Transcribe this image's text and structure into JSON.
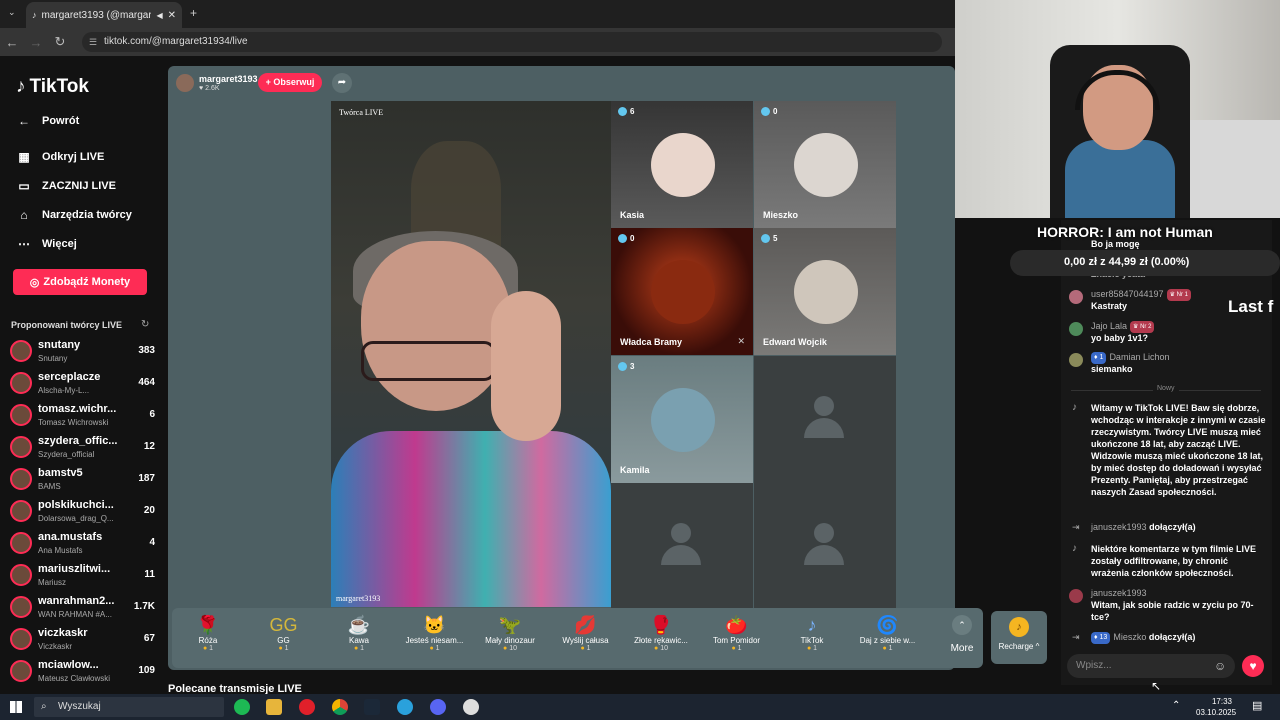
{
  "browser": {
    "tab_title": "margaret3193 (@margaret3...",
    "url": "tiktok.com/@margaret31934/live"
  },
  "sidebar": {
    "logo": "TikTok",
    "back": "Powrót",
    "nav": [
      "Odkryj LIVE",
      "ZACZNIJ LIVE",
      "Narzędzia twórcy",
      "Więcej"
    ],
    "coins_button": "Zdobądź Monety",
    "suggested_title": "Proponowani twórcy LIVE",
    "creators": [
      {
        "name": "snutany",
        "sub": "Snutany",
        "count": "383"
      },
      {
        "name": "serceplacze",
        "sub": "Alscha-My-L...",
        "count": "464"
      },
      {
        "name": "tomasz.wichr...",
        "sub": "Tomasz Wichrowski",
        "count": "6"
      },
      {
        "name": "szydera_offic...",
        "sub": "Szydera_official",
        "count": "12"
      },
      {
        "name": "bamstv5",
        "sub": "BAMS",
        "count": "187"
      },
      {
        "name": "polskikuchci...",
        "sub": "Dolarsowa_drag_Q...",
        "count": "20"
      },
      {
        "name": "ana.mustafs",
        "sub": "Ana Mustafs",
        "count": "4"
      },
      {
        "name": "mariuszlitwi...",
        "sub": "Mariusz",
        "count": "11"
      },
      {
        "name": "wanrahman2...",
        "sub": "WAN RAHMAN #A...",
        "count": "1.7K"
      },
      {
        "name": "viczkaskr",
        "sub": "Viczkaskr",
        "count": "67"
      },
      {
        "name": "mciawlow...",
        "sub": "Mateusz Clawłowski",
        "count": "109"
      }
    ]
  },
  "stage": {
    "host": "margaret3193",
    "likes": "2.6K",
    "follow": "+ Obserwuj",
    "creator_label": "Twórca LIVE",
    "host_label": "margaret3193",
    "tiles": [
      {
        "name": "Kasia",
        "count": "6"
      },
      {
        "name": "Mieszko",
        "count": "0"
      },
      {
        "name": "Władca Bramy",
        "count": "0"
      },
      {
        "name": "Edward Wojcik",
        "count": "5"
      },
      {
        "name": "Kamila",
        "count": "3"
      }
    ],
    "gifts": [
      {
        "name": "Róża",
        "price": "1"
      },
      {
        "name": "GG",
        "price": "1"
      },
      {
        "name": "Kawa",
        "price": "1"
      },
      {
        "name": "Jesteś niesam...",
        "price": "1"
      },
      {
        "name": "Mały dinozaur",
        "price": "10"
      },
      {
        "name": "Wyślij całusa",
        "price": "1"
      },
      {
        "name": "Złote rękawic...",
        "price": "10"
      },
      {
        "name": "Tom Pomidor",
        "price": "1"
      },
      {
        "name": "TikTok",
        "price": "1"
      },
      {
        "name": "Daj z siebie w...",
        "price": "1"
      }
    ],
    "more": "More",
    "recharge": "Recharge ^"
  },
  "recommend_title": "Polecane transmisje LIVE",
  "overlay": {
    "horror": "HORROR: I am not Human",
    "goal": "0,00 zł z 44,99 zł (0.00%)",
    "lastf": "Last f"
  },
  "chat": {
    "top1": "Bo ja mogę",
    "top2": "Znacie yeata",
    "messages": [
      {
        "user": "user85847044197",
        "badge": "Nr 1",
        "text": "Kastraty"
      },
      {
        "user": "Jajo Lala",
        "badge": "Nr 2",
        "text": "yo baby 1v1?"
      },
      {
        "user": "Damian Lichon",
        "level": "1",
        "text": "siemanko"
      }
    ],
    "new": "Nowy",
    "system1": "Witamy w TikTok LIVE! Baw się dobrze, wchodząc w interakcje z innymi w czasie rzeczywistym. Twórcy LIVE muszą mieć ukończone 18 lat, aby zacząć LIVE. Widzowie muszą mieć ukończone 18 lat, by mieć dostęp do doładowań i wysyłać Prezenty. Pamiętaj, aby przestrzegać naszych Zasad społeczności.",
    "joined1_user": "januszek1993",
    "joined": "dołączył(a)",
    "system2": "Niektóre komentarze w tym filmie LIVE zostały odfiltrowane, by chronić wrażenia członków społeczności.",
    "msg4_user": "januszek1993",
    "msg4_text": "Witam, jak sobie radzic w zyciu po 70-tce?",
    "joined2_level": "13",
    "joined2_user": "Mieszko",
    "input_placeholder": "Wpisz..."
  },
  "taskbar": {
    "search": "Wyszukaj",
    "time": "17:33",
    "date": "03.10.2025"
  }
}
